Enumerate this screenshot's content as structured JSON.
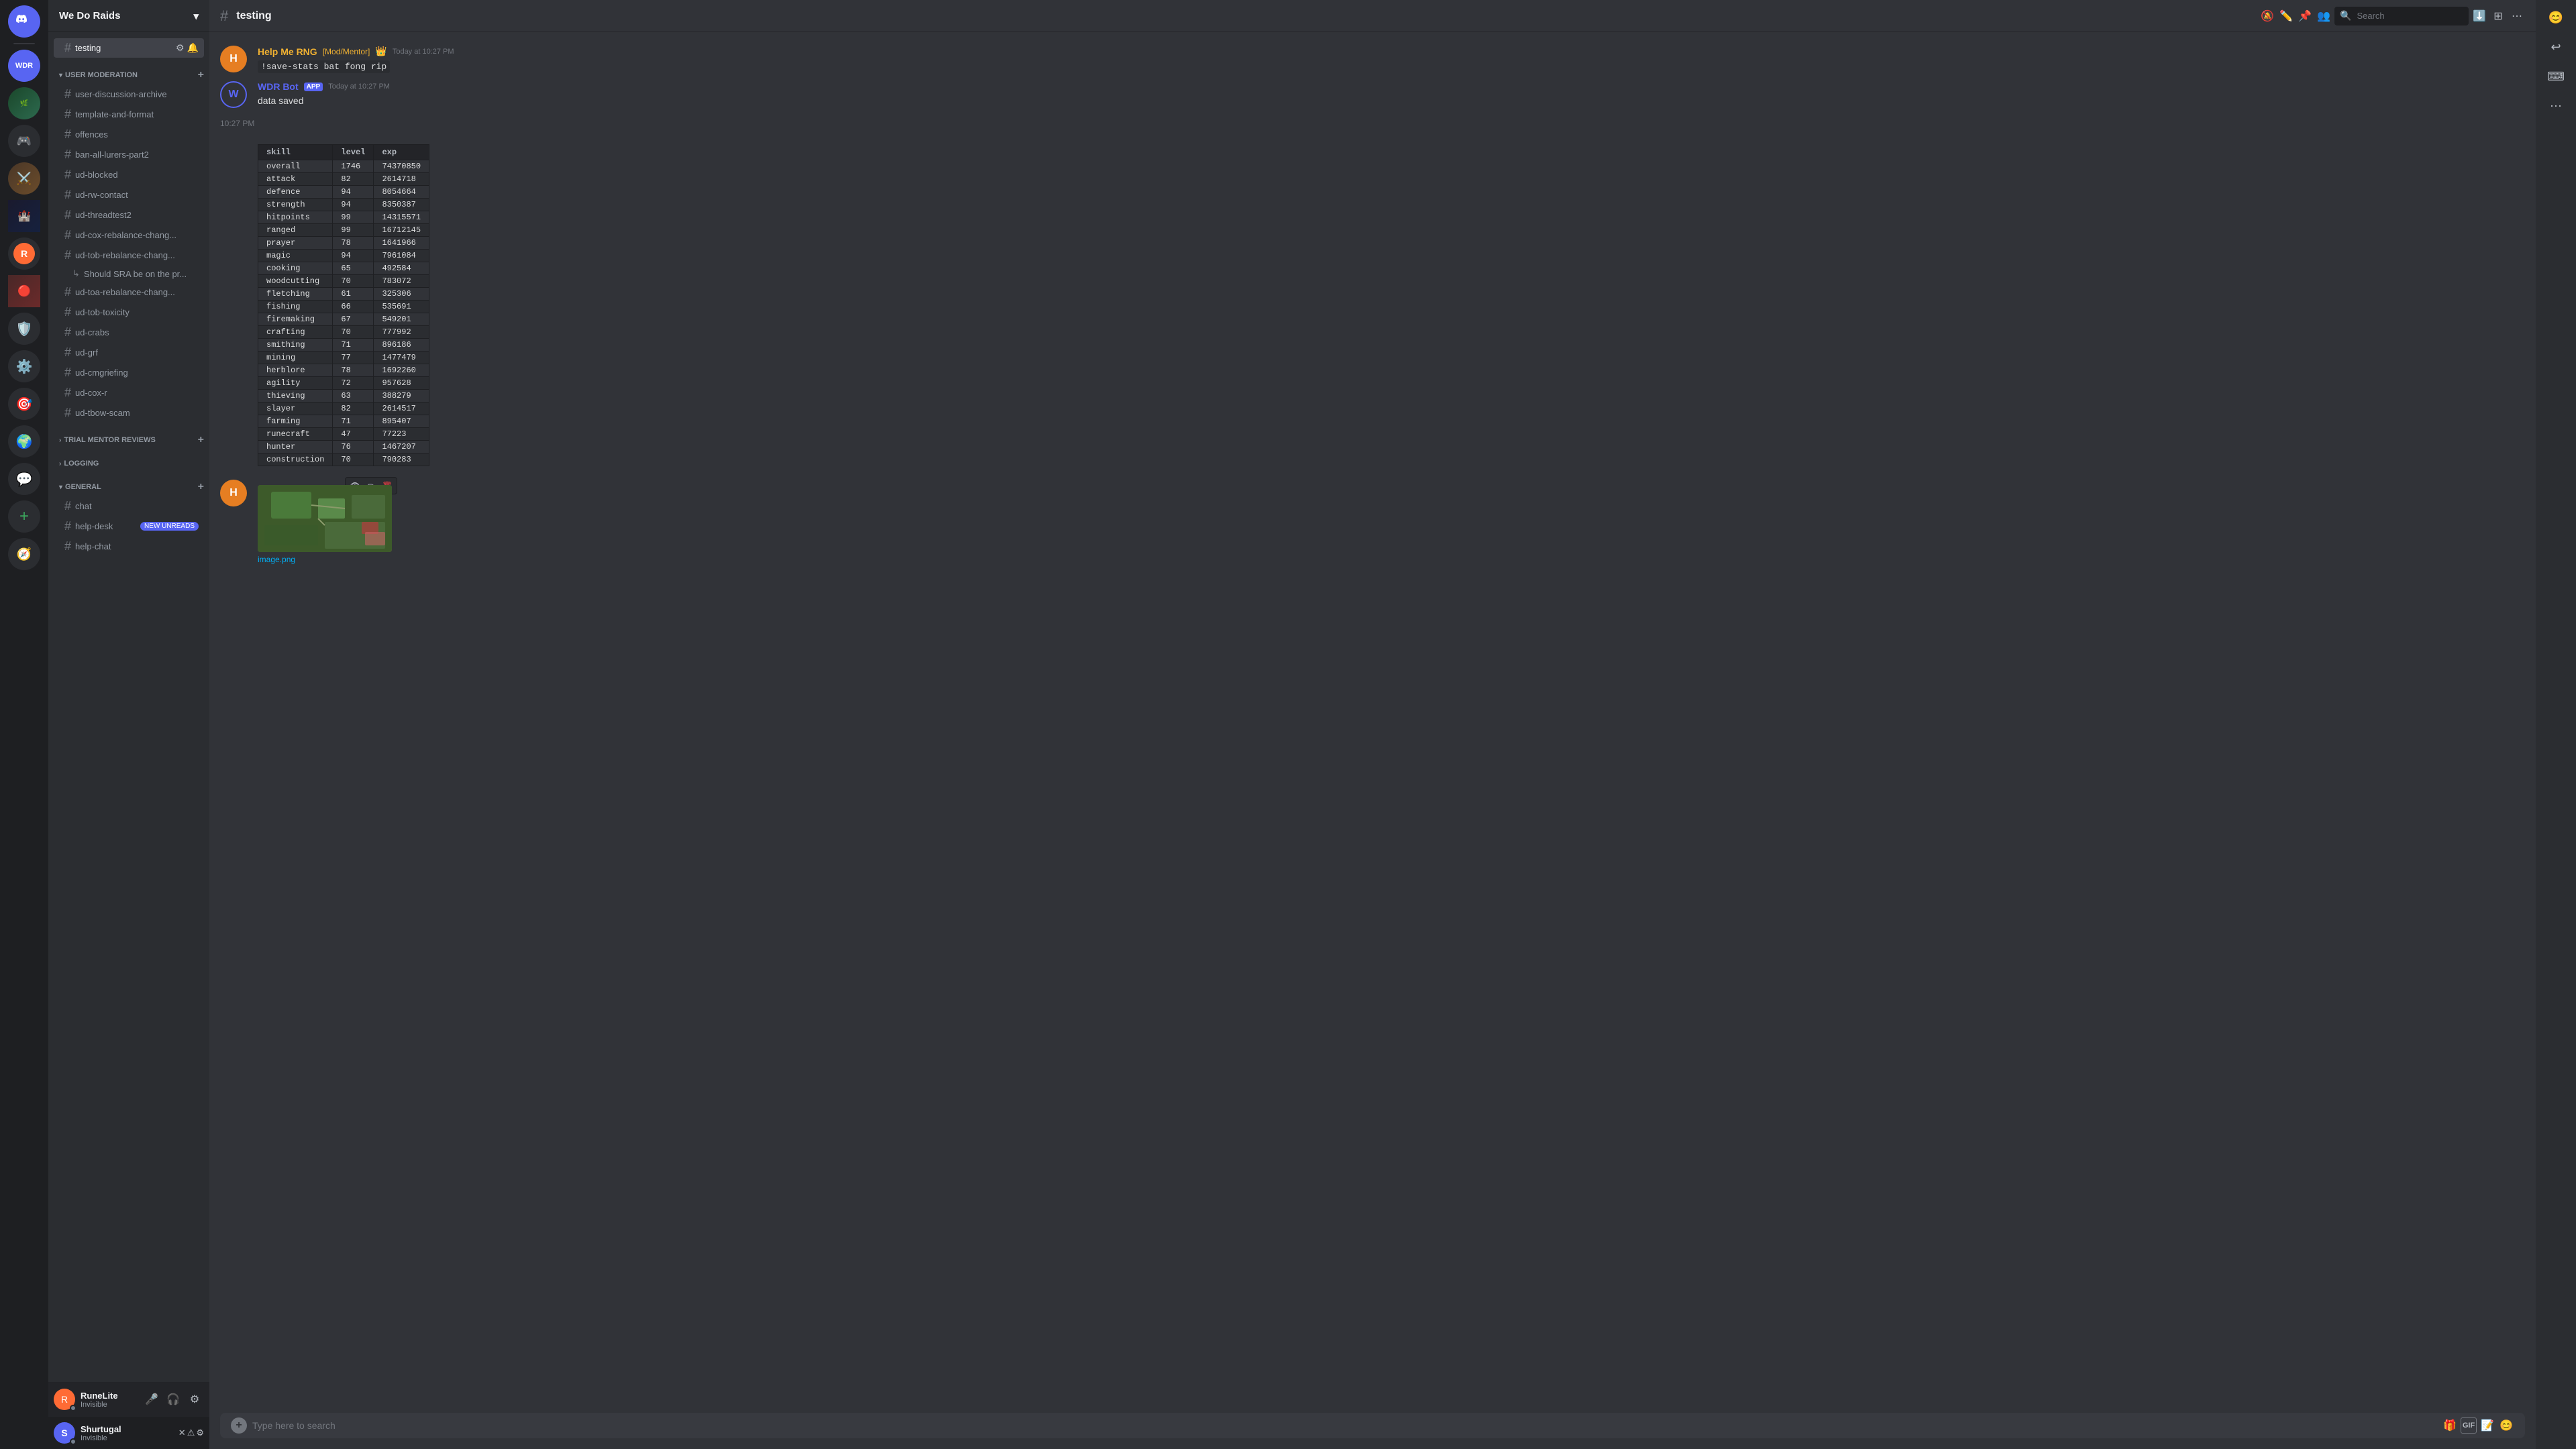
{
  "app": {
    "title": "Discord"
  },
  "server": {
    "name": "We Do Raids",
    "channel_active": "testing"
  },
  "channel_header": {
    "name": "testing",
    "hash": "#"
  },
  "search": {
    "placeholder": "Search",
    "label": "Search"
  },
  "sidebar": {
    "categories": [
      {
        "name": "USER MODERATION",
        "channels": [
          "user-discussion-archive",
          "template-and-format",
          "offences",
          "ban-all-lurers-part2",
          "ud-blocked",
          "ud-rw-contact",
          "ud-threadtest2",
          "ud-cox-rebalance-chang...",
          "ud-tob-rebalance-chang...",
          "Should SRA be on the pr...",
          "ud-toa-rebalance-chang...",
          "ud-tob-toxicity",
          "ud-crabs",
          "ud-grf",
          "ud-cmgriefing",
          "ud-cox-r",
          "ud-tbow-scam"
        ]
      },
      {
        "name": "TRIAL MENTOR REVIEWS",
        "channels": []
      },
      {
        "name": "LOGGING",
        "channels": []
      },
      {
        "name": "GENERAL",
        "channels": [
          "chat",
          "help-desk",
          "help-chat"
        ]
      }
    ]
  },
  "messages": [
    {
      "author": "Help Me RNG [Mod/Mentor]",
      "author_color": "#f0b132",
      "avatar_text": "H",
      "avatar_bg": "#e67e22",
      "badges": [
        "mod"
      ],
      "time": "Today at 10:27 PM",
      "text": "!save-stats bat fong rip",
      "is_bot": false
    },
    {
      "author": "WDR Bot",
      "author_color": "#5865f2",
      "avatar_text": "W",
      "avatar_bg": "#313338",
      "badges": [
        "APP"
      ],
      "time": "Today at 10:27 PM",
      "text": "data saved",
      "is_bot": true,
      "has_table": true
    }
  ],
  "skills_table": {
    "headers": [
      "skill",
      "level",
      "exp"
    ],
    "rows": [
      [
        "overall",
        "1746",
        "74370850"
      ],
      [
        "attack",
        "82",
        "2614718"
      ],
      [
        "defence",
        "94",
        "8054664"
      ],
      [
        "strength",
        "94",
        "8350387"
      ],
      [
        "hitpoints",
        "99",
        "14315571"
      ],
      [
        "ranged",
        "99",
        "16712145"
      ],
      [
        "prayer",
        "78",
        "1641966"
      ],
      [
        "magic",
        "94",
        "7961084"
      ],
      [
        "cooking",
        "65",
        "492584"
      ],
      [
        "woodcutting",
        "70",
        "783072"
      ],
      [
        "fletching",
        "61",
        "325306"
      ],
      [
        "fishing",
        "66",
        "535691"
      ],
      [
        "firemaking",
        "67",
        "549201"
      ],
      [
        "crafting",
        "70",
        "777992"
      ],
      [
        "smithing",
        "71",
        "896186"
      ],
      [
        "mining",
        "77",
        "1477479"
      ],
      [
        "herblore",
        "78",
        "1692260"
      ],
      [
        "agility",
        "72",
        "957628"
      ],
      [
        "thieving",
        "63",
        "388279"
      ],
      [
        "slayer",
        "82",
        "2614517"
      ],
      [
        "farming",
        "71",
        "895407"
      ],
      [
        "runecraft",
        "47",
        "77223"
      ],
      [
        "hunter",
        "76",
        "1467207"
      ],
      [
        "construction",
        "70",
        "790283"
      ]
    ]
  },
  "image_message": {
    "time": "10:27 PM",
    "filename": "image.png"
  },
  "message_input": {
    "placeholder": "Type here to search",
    "channel": "testing"
  },
  "user": {
    "name": "RuneLite",
    "status": "Invisible",
    "avatar_text": "R",
    "avatar_bg": "#ff6b35"
  },
  "bottom_user": {
    "name": "Shurtugal",
    "status": "Invisible",
    "avatar_text": "S",
    "avatar_bg": "#5865f2"
  },
  "toolbar": {
    "bell_icon": "🔕",
    "edit_icon": "✏️",
    "members_icon": "👥",
    "search_icon": "🔍",
    "download_icon": "⬇️",
    "apps_icon": "⊞",
    "more_icon": "⋯",
    "gift_icon": "🎁",
    "gif_icon": "GIF",
    "sticker_icon": "📝",
    "emoji_icon": "😊",
    "add_icon": "+"
  },
  "new_unreads_label": "NEW UNREADS"
}
